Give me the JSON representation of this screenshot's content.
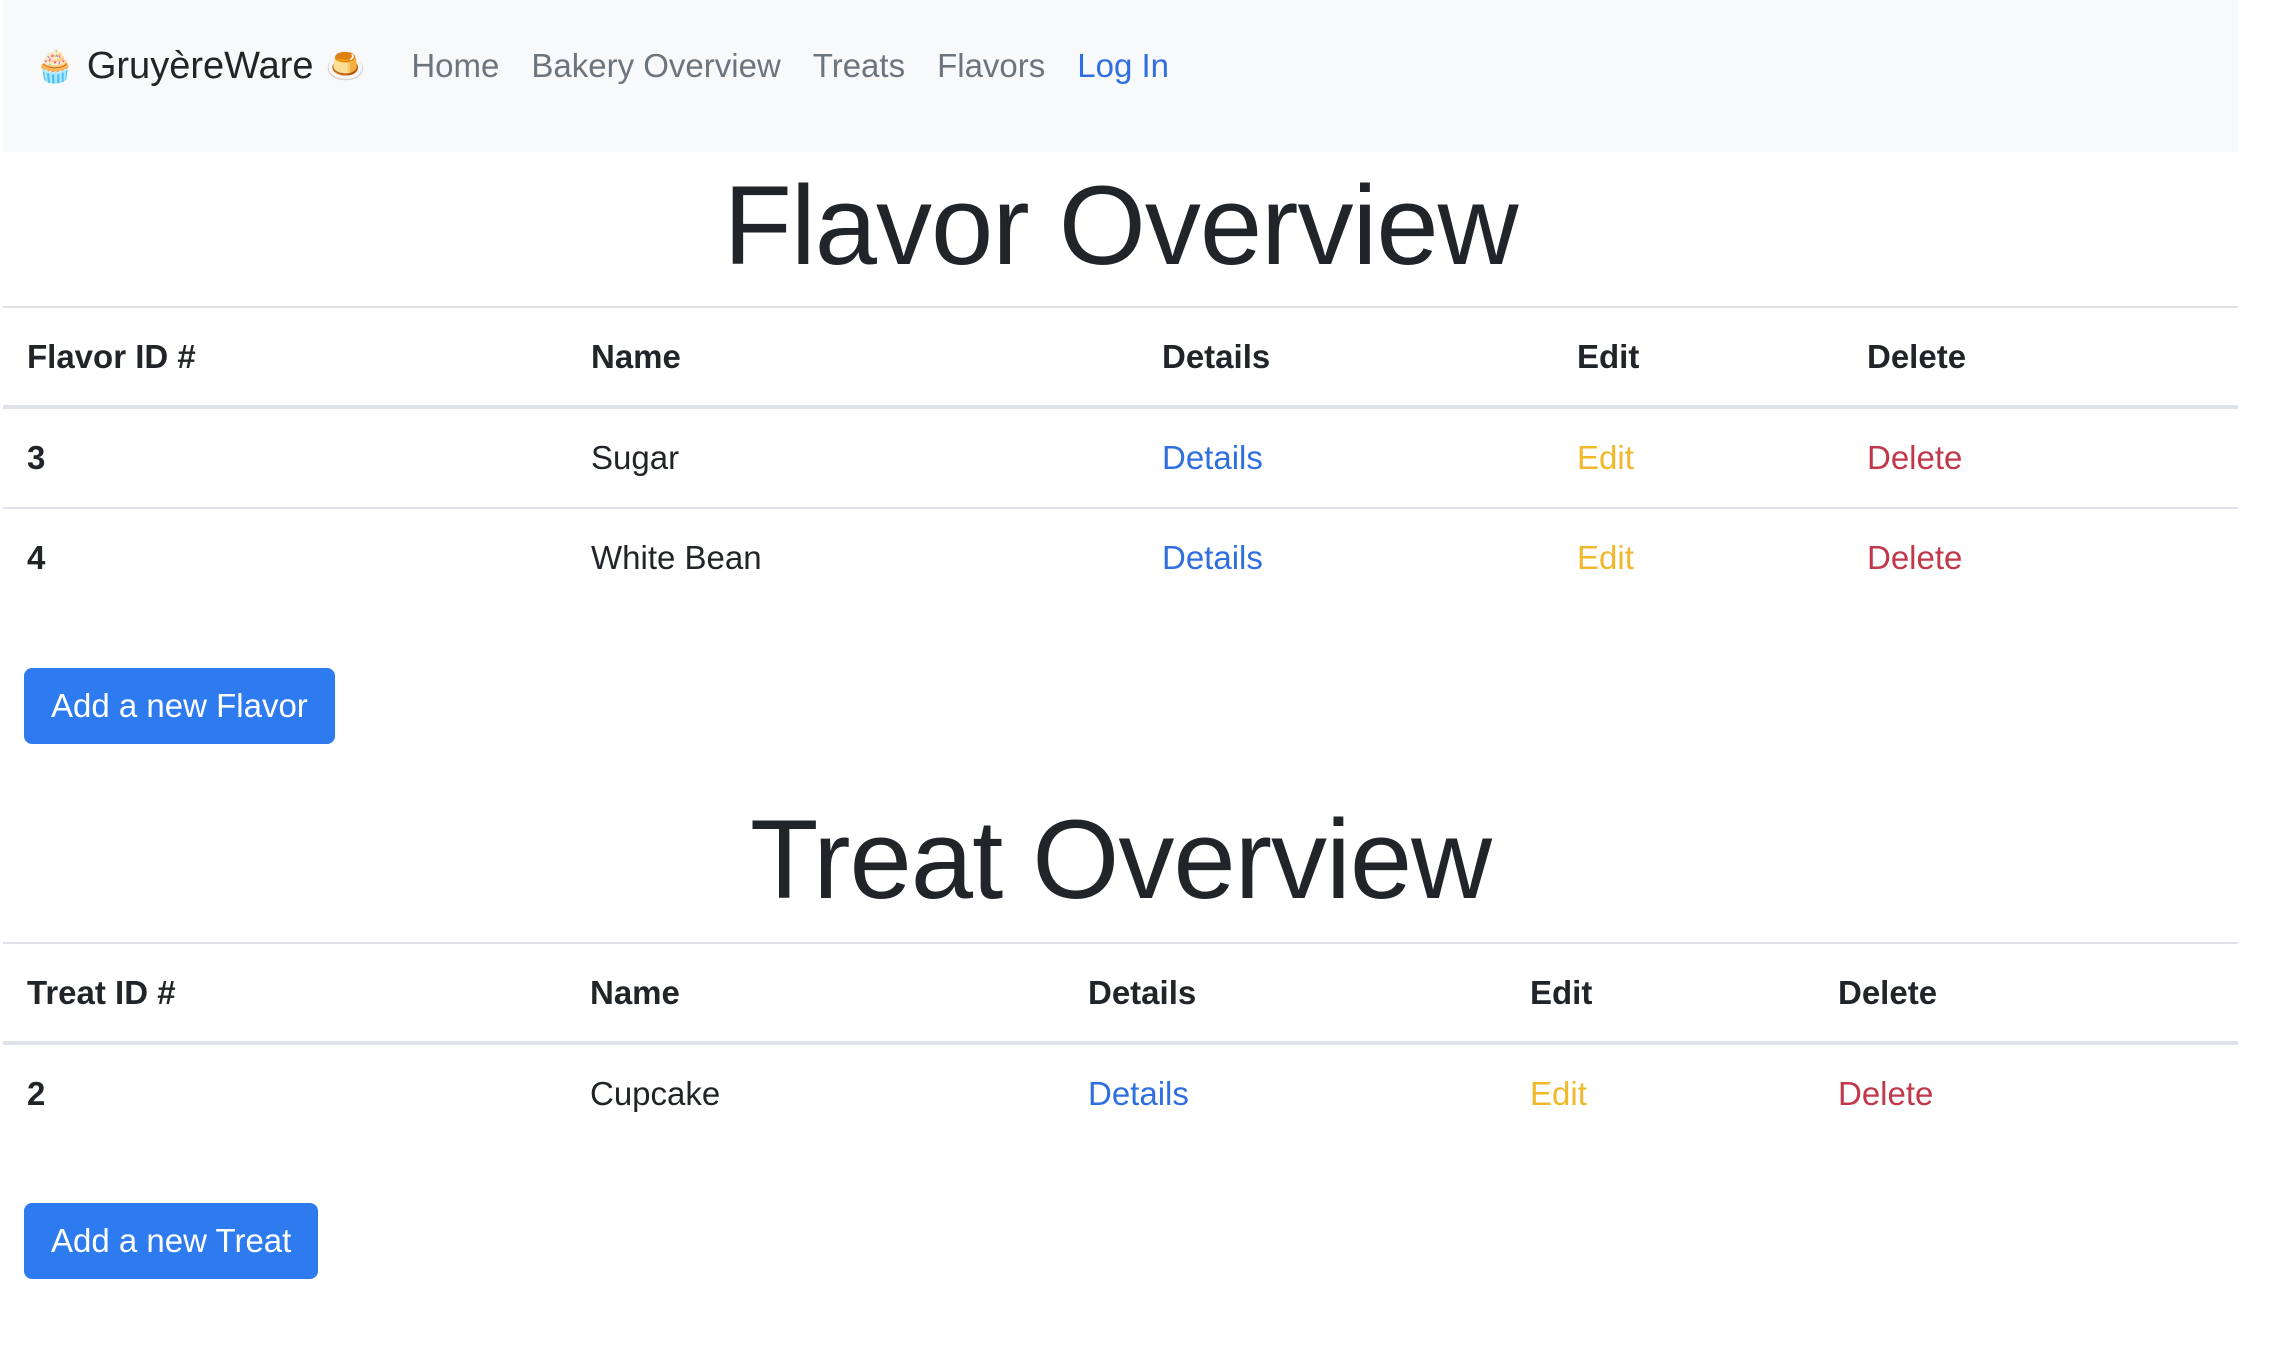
{
  "navbar": {
    "brand": "GruyèreWare",
    "brand_emoji_left": "🧁",
    "brand_emoji_right": "🍮",
    "links": [
      "Home",
      "Bakery Overview",
      "Treats",
      "Flavors",
      "Log In"
    ]
  },
  "flavors": {
    "title": "Flavor Overview",
    "headers": [
      "Flavor ID #",
      "Name",
      "Details",
      "Edit",
      "Delete"
    ],
    "rows": [
      {
        "id": "3",
        "name": "Sugar",
        "details": "Details",
        "edit": "Edit",
        "delete": "Delete"
      },
      {
        "id": "4",
        "name": "White Bean",
        "details": "Details",
        "edit": "Edit",
        "delete": "Delete"
      }
    ],
    "add_button": "Add a new Flavor"
  },
  "treats": {
    "title": "Treat Overview",
    "headers": [
      "Treat ID #",
      "Name",
      "Details",
      "Edit",
      "Delete"
    ],
    "rows": [
      {
        "id": "2",
        "name": "Cupcake",
        "details": "Details",
        "edit": "Edit",
        "delete": "Delete"
      }
    ],
    "add_button": "Add a new Treat"
  },
  "colors": {
    "navbar_bg": "#f8f9fa",
    "link_blue": "#2f6fe0",
    "edit_yellow": "#f0b92c",
    "delete_red": "#c0394b",
    "button_blue": "#2e7bf0"
  }
}
